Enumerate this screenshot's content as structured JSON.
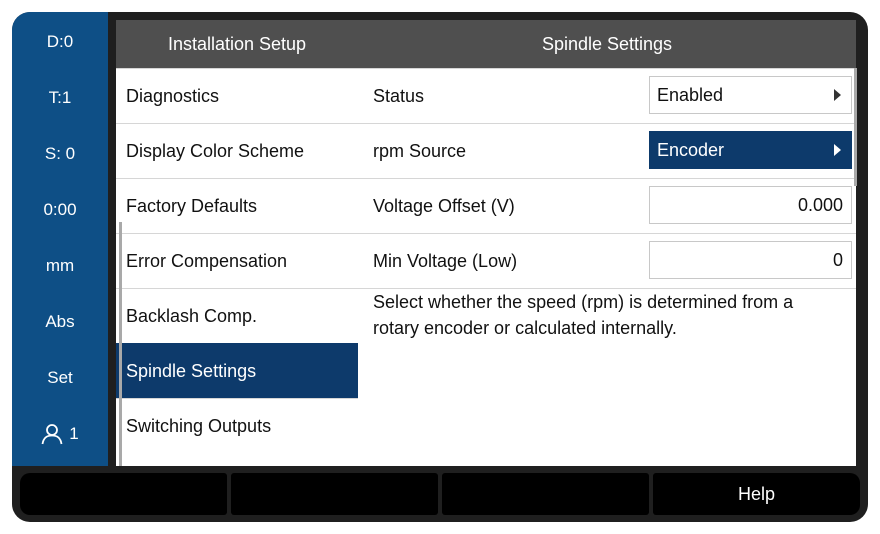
{
  "status_bar": {
    "items": [
      "D:0",
      "T:1",
      "S: 0",
      "0:00",
      "mm",
      "Abs",
      "Set"
    ],
    "user_number": "1",
    "user_icon": "user-icon"
  },
  "left_panel": {
    "title": "Installation Setup",
    "items": [
      "Diagnostics",
      "Display Color Scheme",
      "Factory Defaults",
      "Error Compensation",
      "Backlash Comp.",
      "Spindle Settings",
      "Switching Outputs"
    ],
    "selected": "Spindle Settings"
  },
  "right_panel": {
    "title": "Spindle Settings",
    "settings": [
      {
        "label": "Status",
        "value": "Enabled"
      },
      {
        "label": "rpm Source",
        "value": "Encoder"
      },
      {
        "label": "Voltage Offset (V)",
        "value": "0.000"
      },
      {
        "label": "Min Voltage (Low)",
        "value": "0"
      }
    ],
    "description": "Select whether the speed (rpm) is determined from a rotary encoder or calculated internally."
  },
  "softkeys": [
    "",
    "",
    "",
    "Help"
  ],
  "colors": {
    "status_bar": "#0e4f86",
    "header": "#4f4f4f",
    "selection": "#0d3a6b",
    "frame": "#1f1f1f",
    "softkey": "#000000"
  }
}
